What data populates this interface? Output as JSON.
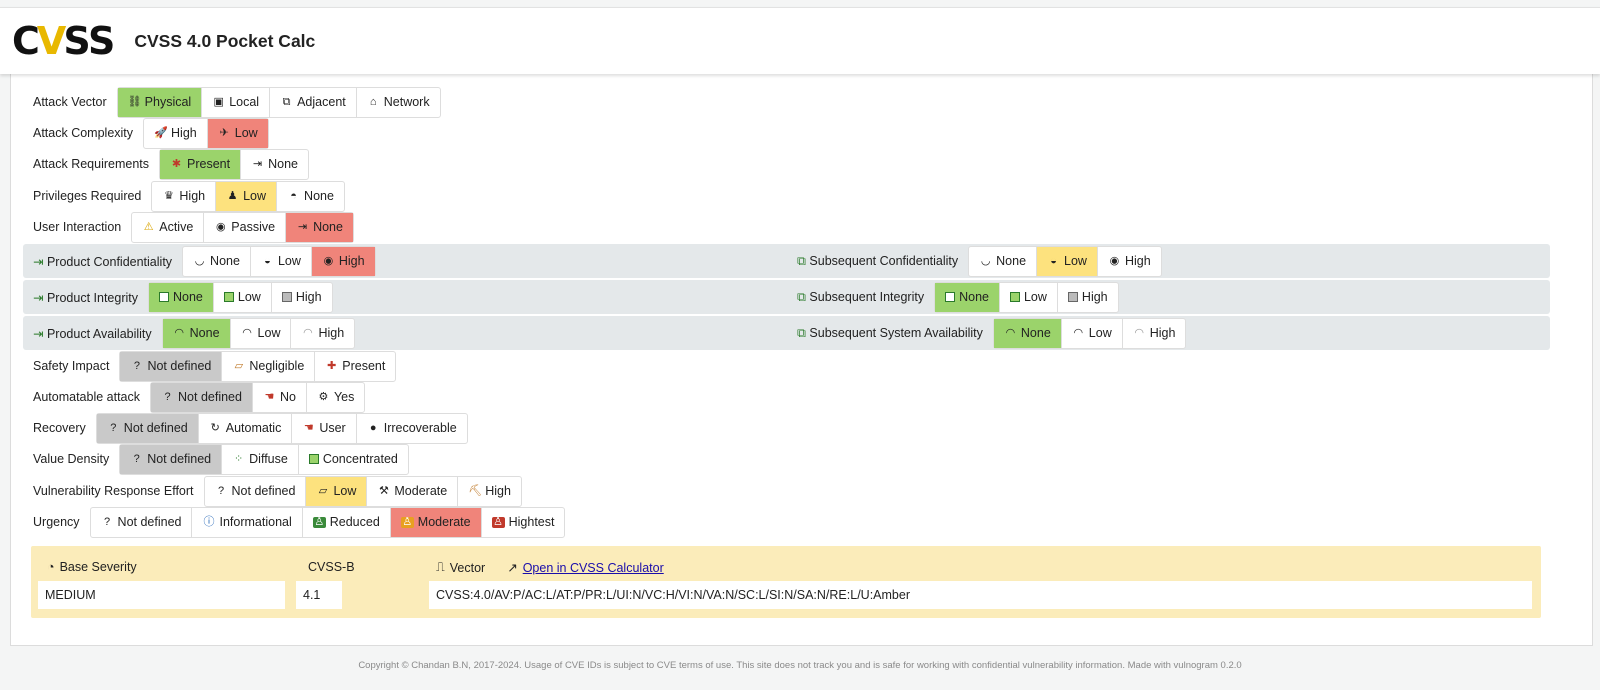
{
  "header": {
    "logo_text_left": "C",
    "logo_text_v": "V",
    "logo_text_right": "SS",
    "title": "CVSS 4.0 Pocket Calc"
  },
  "metrics": {
    "av": {
      "label": "Attack Vector",
      "options": [
        "Physical",
        "Local",
        "Adjacent",
        "Network"
      ]
    },
    "ac": {
      "label": "Attack Complexity",
      "options": [
        "High",
        "Low"
      ]
    },
    "at": {
      "label": "Attack Requirements",
      "options": [
        "Present",
        "None"
      ]
    },
    "pr": {
      "label": "Privileges Required",
      "options": [
        "High",
        "Low",
        "None"
      ]
    },
    "ui": {
      "label": "User Interaction",
      "options": [
        "Active",
        "Passive",
        "None"
      ]
    },
    "vc": {
      "label": "Product Confidentiality",
      "options": [
        "None",
        "Low",
        "High"
      ]
    },
    "sc": {
      "label": "Subsequent Confidentiality",
      "options": [
        "None",
        "Low",
        "High"
      ]
    },
    "vi": {
      "label": "Product Integrity",
      "options": [
        "None",
        "Low",
        "High"
      ]
    },
    "si": {
      "label": "Subsequent Integrity",
      "options": [
        "None",
        "Low",
        "High"
      ]
    },
    "va": {
      "label": "Product Availability",
      "options": [
        "None",
        "Low",
        "High"
      ]
    },
    "sa": {
      "label": "Subsequent System Availability",
      "options": [
        "None",
        "Low",
        "High"
      ]
    },
    "s": {
      "label": "Safety Impact",
      "options": [
        "Not defined",
        "Negligible",
        "Present"
      ]
    },
    "au": {
      "label": "Automatable attack",
      "options": [
        "Not defined",
        "No",
        "Yes"
      ]
    },
    "r": {
      "label": "Recovery",
      "options": [
        "Not defined",
        "Automatic",
        "User",
        "Irrecoverable"
      ]
    },
    "v": {
      "label": "Value Density",
      "options": [
        "Not defined",
        "Diffuse",
        "Concentrated"
      ]
    },
    "re": {
      "label": "Vulnerability Response Effort",
      "options": [
        "Not defined",
        "Low",
        "Moderate",
        "High"
      ]
    },
    "u": {
      "label": "Urgency",
      "options": [
        "Not defined",
        "Informational",
        "Reduced",
        "Moderate",
        "Hightest"
      ]
    }
  },
  "colors": {
    "selected_green": "#9bd36b",
    "selected_red": "#f0847a",
    "selected_yellow": "#fde27e",
    "selected_gray": "#c9c9c9",
    "summary_bg": "#fbecba"
  },
  "summary": {
    "severity_label": "Base Severity",
    "severity_value": "MEDIUM",
    "score_label": "CVSS-B",
    "score_value": "4.1",
    "vector_label": "Vector",
    "open_link": "Open in CVSS Calculator",
    "vector_value": "CVSS:4.0/AV:P/AC:L/AT:P/PR:L/UI:N/VC:H/VI:N/VA:N/SC:L/SI:N/SA:N/RE:L/U:Amber"
  },
  "footer": {
    "text": "Copyright © Chandan B.N, 2017-2024. Usage of CVE IDs is subject to CVE terms of use. This site does not track you and is safe for working with confidential vulnerability information. Made with vulnogram 0.2.0"
  }
}
